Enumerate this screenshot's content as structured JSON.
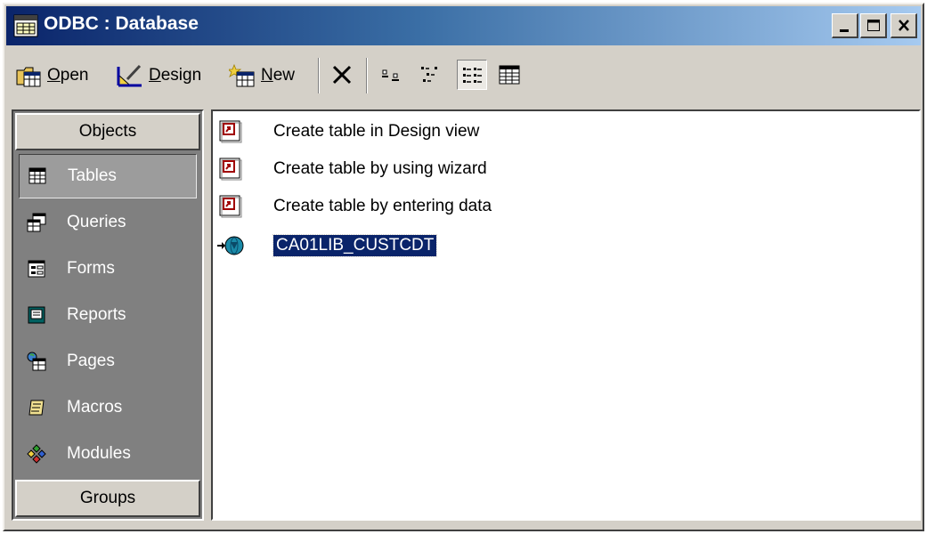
{
  "window": {
    "title": "ODBC : Database"
  },
  "toolbar": {
    "open": {
      "prefix": "",
      "accel": "O",
      "rest": "pen"
    },
    "design": {
      "prefix": "",
      "accel": "D",
      "rest": "esign"
    },
    "new": {
      "prefix": "",
      "accel": "N",
      "rest": "ew"
    }
  },
  "objects_bar": {
    "objects_label": "Objects",
    "groups_label": "Groups",
    "items": [
      {
        "label": "Tables",
        "icon": "table-icon",
        "selected": true
      },
      {
        "label": "Queries",
        "icon": "query-icon",
        "selected": false
      },
      {
        "label": "Forms",
        "icon": "form-icon",
        "selected": false
      },
      {
        "label": "Reports",
        "icon": "report-icon",
        "selected": false
      },
      {
        "label": "Pages",
        "icon": "page-icon",
        "selected": false
      },
      {
        "label": "Macros",
        "icon": "macro-icon",
        "selected": false
      },
      {
        "label": "Modules",
        "icon": "module-icon",
        "selected": false
      }
    ]
  },
  "list": {
    "items": [
      {
        "label": "Create table in Design view",
        "icon": "shortcut-icon"
      },
      {
        "label": "Create table by using wizard",
        "icon": "shortcut-icon"
      },
      {
        "label": "Create table by entering data",
        "icon": "shortcut-icon"
      },
      {
        "label": "CA01LIB_CUSTCDT",
        "icon": "linked-odbc-table-icon",
        "selected": true
      }
    ]
  },
  "colors": {
    "title_start": "#0a246a",
    "title_end": "#a6caf0",
    "selection": "#0a246a",
    "face": "#d4d0c8"
  }
}
